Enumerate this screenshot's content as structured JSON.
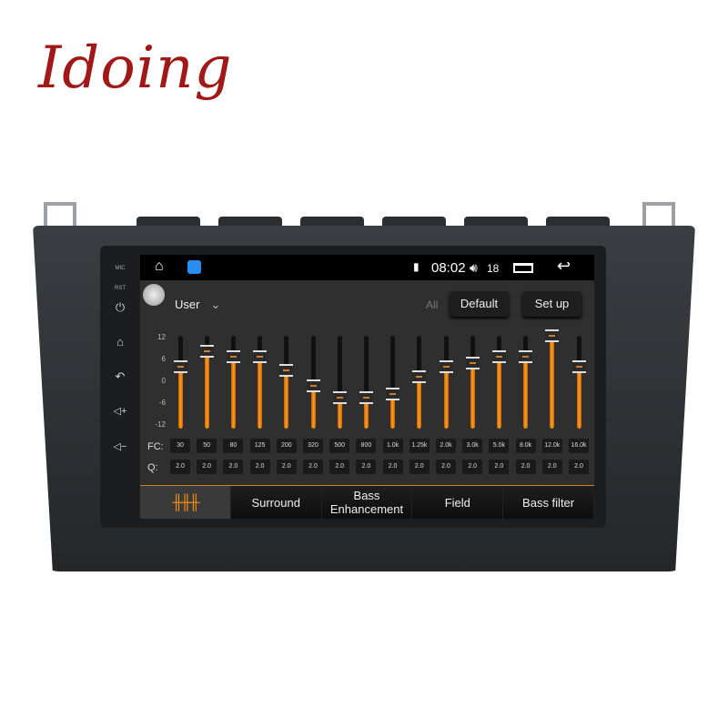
{
  "brand": {
    "logo": "Idoing"
  },
  "device_keys": {
    "mic": "MIC",
    "rst": "RST",
    "icons": [
      "power-icon",
      "home-icon",
      "back-icon",
      "volume-up-icon",
      "volume-down-icon"
    ]
  },
  "status_bar": {
    "time": "08:02",
    "volume": "18",
    "icons": [
      "home-icon",
      "app-icon",
      "sim-icon",
      "volume-icon",
      "recent-apps-icon",
      "back-icon"
    ]
  },
  "eq": {
    "preset": "User",
    "all_label": "All",
    "default_label": "Default",
    "setup_label": "Set up",
    "scale": [
      "12",
      "6",
      "0",
      "-6",
      "-12"
    ],
    "scale_range": [
      -12,
      12
    ],
    "fc_label": "FC:",
    "q_label": "Q:",
    "accent_color": "#f5900f",
    "bands": [
      {
        "fc": "30",
        "q": "2.0",
        "gain": 4
      },
      {
        "fc": "50",
        "q": "2.0",
        "gain": 8
      },
      {
        "fc": "80",
        "q": "2.0",
        "gain": 6.5
      },
      {
        "fc": "125",
        "q": "2.0",
        "gain": 6.5
      },
      {
        "fc": "200",
        "q": "2.0",
        "gain": 3
      },
      {
        "fc": "320",
        "q": "2.0",
        "gain": -1
      },
      {
        "fc": "500",
        "q": "2.0",
        "gain": -4
      },
      {
        "fc": "800",
        "q": "2.0",
        "gain": -4
      },
      {
        "fc": "1.0k",
        "q": "2.0",
        "gain": -3
      },
      {
        "fc": "1.25k",
        "q": "2.0",
        "gain": 1.5
      },
      {
        "fc": "2.0k",
        "q": "2.0",
        "gain": 4
      },
      {
        "fc": "3.0k",
        "q": "2.0",
        "gain": 5
      },
      {
        "fc": "5.0k",
        "q": "2.0",
        "gain": 6.5
      },
      {
        "fc": "8.0k",
        "q": "2.0",
        "gain": 6.5
      },
      {
        "fc": "12.0k",
        "q": "2.0",
        "gain": 12
      },
      {
        "fc": "16.0k",
        "q": "2.0",
        "gain": 4
      }
    ]
  },
  "tabs": [
    {
      "label": "",
      "icon": "equalizer-icon",
      "active": true
    },
    {
      "label": "Surround"
    },
    {
      "label": "Bass\nEnhancement"
    },
    {
      "label": "Field"
    },
    {
      "label": "Bass filter"
    }
  ]
}
